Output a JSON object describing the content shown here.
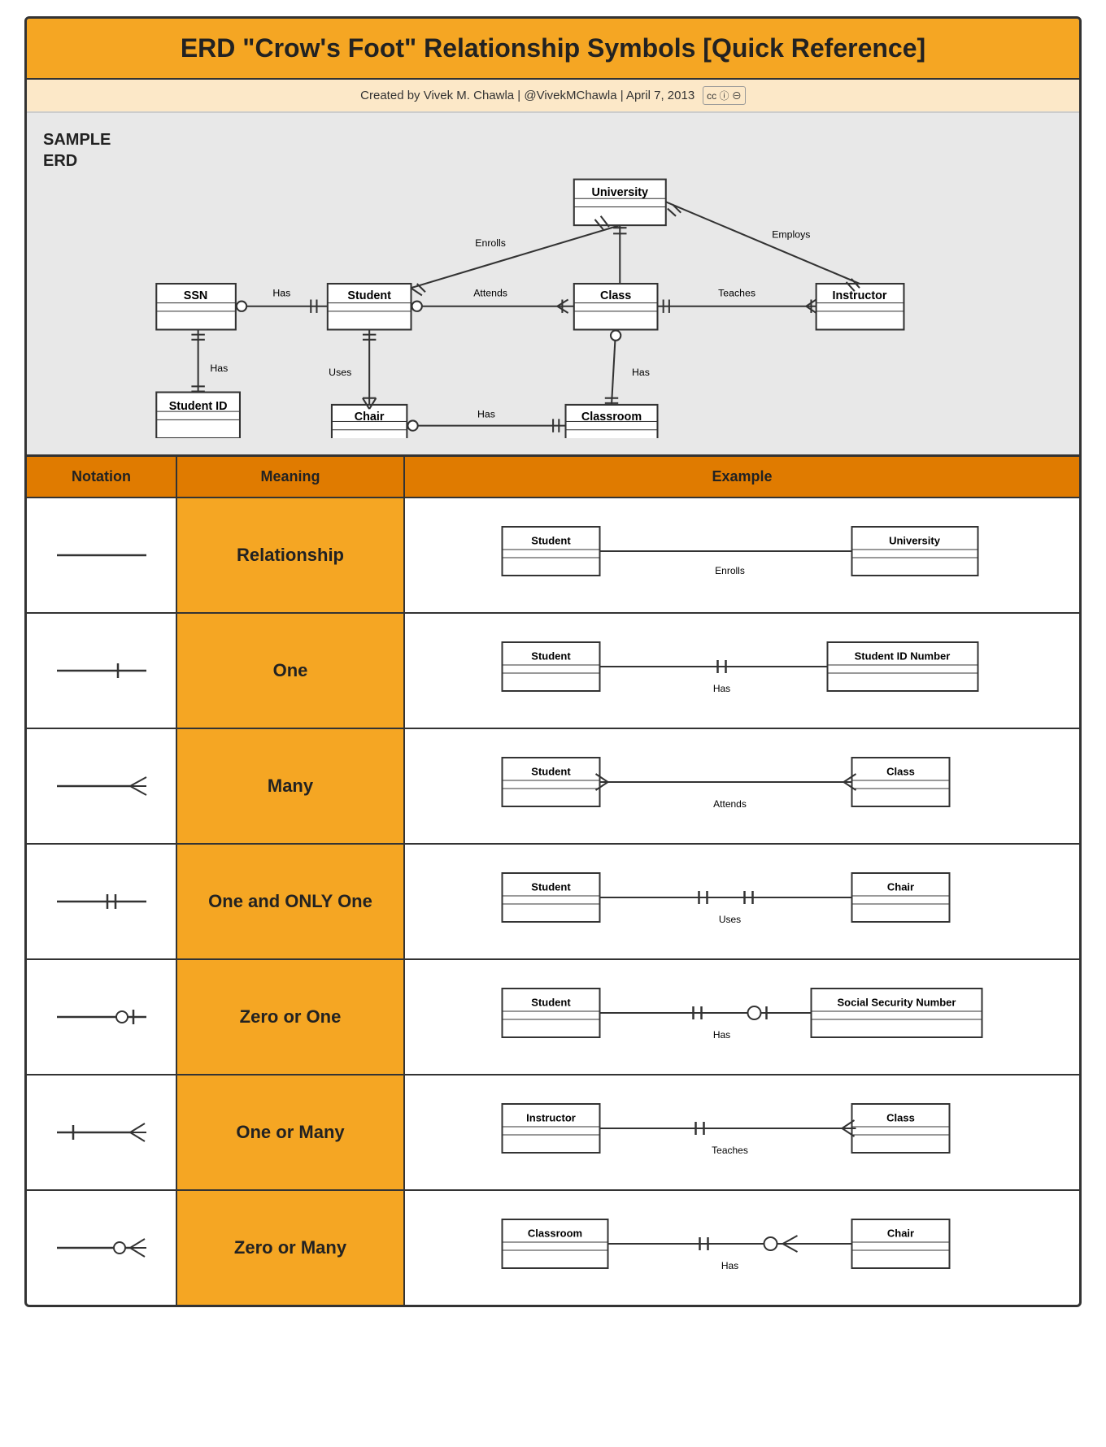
{
  "title": "ERD \"Crow's Foot\" Relationship Symbols [Quick Reference]",
  "subtitle": "Created by Vivek M. Chawla | @VivekMChawla | April 7, 2013",
  "erd_label": "SAMPLE\nERD",
  "table_headers": {
    "notation": "Notation",
    "meaning": "Meaning",
    "example": "Example"
  },
  "rows": [
    {
      "meaning": "Relationship",
      "entity1": "Student",
      "entity2": "University",
      "relation": "Enrolls",
      "notation_type": "plain"
    },
    {
      "meaning": "One",
      "entity1": "Student",
      "entity2": "Student ID Number",
      "relation": "Has",
      "notation_type": "one"
    },
    {
      "meaning": "Many",
      "entity1": "Student",
      "entity2": "Class",
      "relation": "Attends",
      "notation_type": "many"
    },
    {
      "meaning": "One and ONLY One",
      "entity1": "Student",
      "entity2": "Chair",
      "relation": "Uses",
      "notation_type": "one_only"
    },
    {
      "meaning": "Zero or One",
      "entity1": "Student",
      "entity2": "Social Security Number",
      "relation": "Has",
      "notation_type": "zero_one"
    },
    {
      "meaning": "One or Many",
      "entity1": "Instructor",
      "entity2": "Class",
      "relation": "Teaches",
      "notation_type": "one_many"
    },
    {
      "meaning": "Zero or Many",
      "entity1": "Classroom",
      "entity2": "Chair",
      "relation": "Has",
      "notation_type": "zero_many"
    }
  ]
}
